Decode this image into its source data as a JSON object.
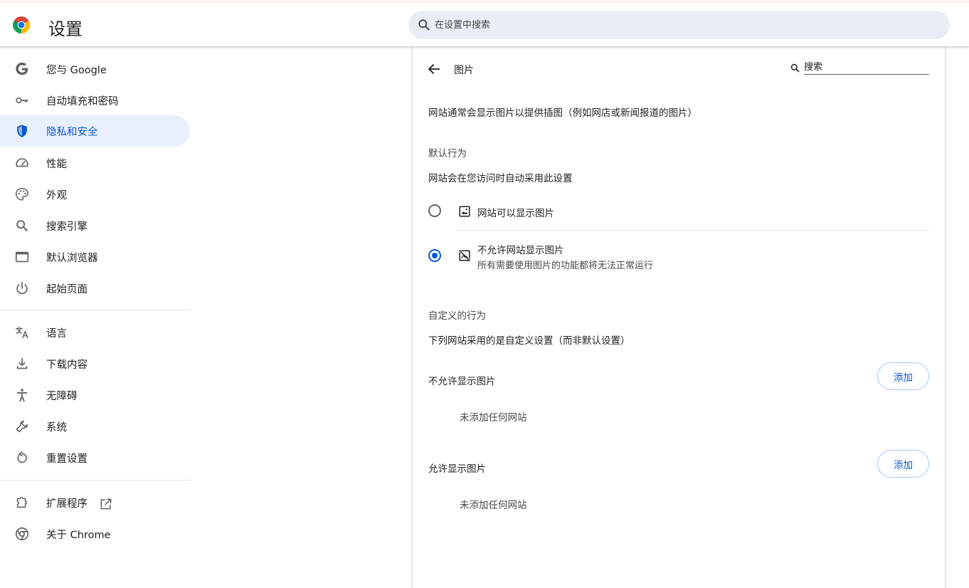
{
  "header": {
    "title": "设置",
    "search_placeholder": "在设置中搜索"
  },
  "sidebar": {
    "items": [
      {
        "label": "您与 Google",
        "icon": "google-g-icon"
      },
      {
        "label": "自动填充和密码",
        "icon": "key-icon"
      },
      {
        "label": "隐私和安全",
        "icon": "shield-icon",
        "active": true
      },
      {
        "label": "性能",
        "icon": "speedometer-icon"
      },
      {
        "label": "外观",
        "icon": "palette-icon"
      },
      {
        "label": "搜索引擎",
        "icon": "search-icon"
      },
      {
        "label": "默认浏览器",
        "icon": "browser-window-icon"
      },
      {
        "label": "起始页面",
        "icon": "power-icon"
      },
      {
        "label": "语言",
        "icon": "translate-icon"
      },
      {
        "label": "下载内容",
        "icon": "download-icon"
      },
      {
        "label": "无障碍",
        "icon": "accessibility-icon"
      },
      {
        "label": "系统",
        "icon": "wrench-icon"
      },
      {
        "label": "重置设置",
        "icon": "reset-icon"
      },
      {
        "label": "扩展程序",
        "icon": "puzzle-icon"
      },
      {
        "label": "关于 Chrome",
        "icon": "chrome-icon"
      }
    ]
  },
  "content": {
    "page_title": "图片",
    "search_placeholder": "搜索",
    "description": "网站通常会显示图片以提供插图（例如网店或新闻报道的图片）",
    "default_behavior": {
      "heading": "默认行为",
      "subtitle": "网站会在您访问时自动采用此设置",
      "options": [
        {
          "label": "网站可以显示图片",
          "sublabel": "",
          "checked": false,
          "icon": "image-icon"
        },
        {
          "label": "不允许网站显示图片",
          "sublabel": "所有需要使用图片的功能都将无法正常运行",
          "checked": true,
          "icon": "image-off-icon"
        }
      ]
    },
    "custom_behavior": {
      "heading": "自定义的行为",
      "subtitle": "下列网站采用的是自定义设置（而非默认设置）",
      "sections": [
        {
          "title": "不允许显示图片",
          "add_label": "添加",
          "empty_text": "未添加任何网站"
        },
        {
          "title": "允许显示图片",
          "add_label": "添加",
          "empty_text": "未添加任何网站"
        }
      ]
    }
  },
  "colors": {
    "accent": "#0b57d0",
    "active_bg": "#e8f0fe",
    "search_bg": "#e9eef6"
  }
}
